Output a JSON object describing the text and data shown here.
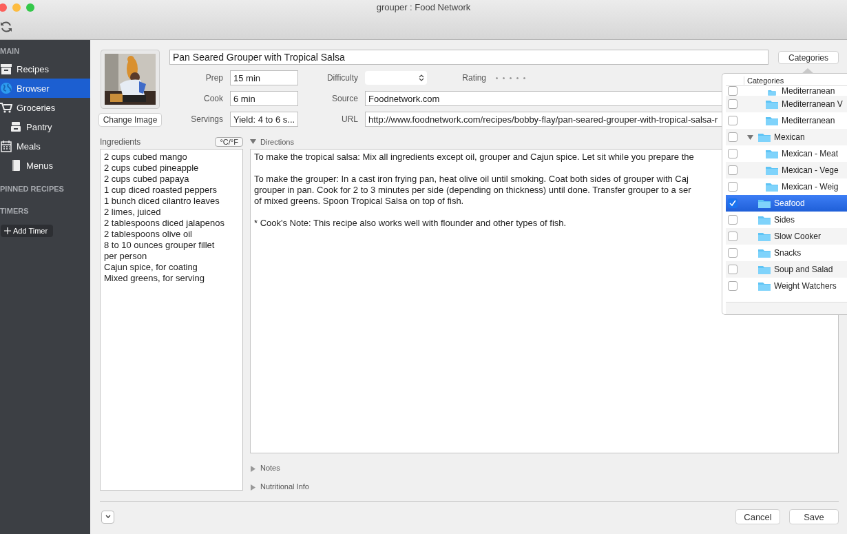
{
  "window": {
    "title": "grouper : Food Network"
  },
  "sidebar": {
    "sections": [
      {
        "header": "MAIN",
        "items": [
          {
            "label": "Recipes",
            "selected": false
          },
          {
            "label": "Browser",
            "selected": true
          },
          {
            "label": "Groceries",
            "selected": false,
            "children": [
              {
                "label": "Pantry",
                "selected": false
              }
            ]
          },
          {
            "label": "Meals",
            "selected": false,
            "children": [
              {
                "label": "Menus",
                "selected": false
              }
            ]
          }
        ]
      },
      {
        "header": "PINNED RECIPES"
      },
      {
        "header": "TIMERS"
      }
    ],
    "add_timer": "Add Timer"
  },
  "recipe": {
    "change_image": "Change Image",
    "title": "Pan Seared Grouper with Tropical Salsa",
    "categories_button": "Categories",
    "fields": [
      {
        "label": "Prep",
        "value": "15 min"
      },
      {
        "label": "Difficulty",
        "kind": "select"
      },
      {
        "label": "Rating",
        "kind": "rating",
        "stars": 0
      },
      {
        "label": "Cook",
        "value": "6 min"
      },
      {
        "label": "Source",
        "value": "Foodnetwork.com"
      },
      {
        "label": "Servings",
        "value": "Yield: 4 to 6 s..."
      },
      {
        "label": "URL",
        "value": "http://www.foodnetwork.com/recipes/bobby-flay/pan-seared-grouper-with-tropical-salsa-r"
      }
    ],
    "ingredients": {
      "label": "Ingredients",
      "units_button": "°C/°F",
      "lines": [
        "2 cups cubed mango",
        "2 cups cubed pineapple",
        "2 cups cubed papaya",
        "1 cup diced roasted peppers",
        "1 bunch diced cilantro leaves",
        "2 limes, juiced",
        "2 tablespoons diced jalapenos",
        "2 tablespoons olive oil",
        "8 to 10 ounces grouper fillet",
        "per person",
        "Cajun spice, for coating",
        "Mixed greens, for serving"
      ]
    },
    "sections": [
      {
        "label": "Directions",
        "expanded": true,
        "paragraphs": [
          [
            "To make the tropical salsa: Mix all ingredients except oil, grouper and Cajun spice. Let sit while you prepare the"
          ],
          [
            "To make the grouper: In a cast iron frying pan, heat olive oil until smoking. Coat both sides of grouper with Caj",
            "grouper in pan. Cook for 2 to 3 minutes per side (depending on thickness) until done. Transfer grouper to a ser",
            "of mixed greens. Spoon Tropical Salsa on top of fish."
          ],
          [
            "* Cook's Note: This recipe also works well with flounder and other types of fish."
          ]
        ]
      },
      {
        "label": "Notes",
        "expanded": false
      },
      {
        "label": "Nutritional Info",
        "expanded": false
      }
    ],
    "buttons": [
      "Cancel",
      "Save"
    ]
  },
  "categories_popover": {
    "header": "Categories",
    "scrolled_children": [
      {
        "label": "Mediterranean",
        "checked": false,
        "selected": false
      },
      {
        "label": "Mediterranean V",
        "checked": false,
        "selected": false
      },
      {
        "label": "Mediterranean",
        "checked": false,
        "selected": false
      }
    ],
    "items": [
      {
        "label": "Mexican",
        "checked": false,
        "selected": false,
        "expanded": true,
        "children": [
          {
            "label": "Mexican - Meat",
            "checked": false,
            "selected": false
          },
          {
            "label": "Mexican - Vege",
            "checked": false,
            "selected": false
          },
          {
            "label": "Mexican - Weig",
            "checked": false,
            "selected": false
          }
        ]
      },
      {
        "label": "Seafood",
        "checked": true,
        "selected": true
      },
      {
        "label": "Sides",
        "checked": false,
        "selected": false
      },
      {
        "label": "Slow Cooker",
        "checked": false,
        "selected": false
      },
      {
        "label": "Snacks",
        "checked": false,
        "selected": false
      },
      {
        "label": "Soup and Salad",
        "checked": false,
        "selected": false
      },
      {
        "label": "Weight Watchers",
        "checked": false,
        "selected": false
      }
    ]
  }
}
